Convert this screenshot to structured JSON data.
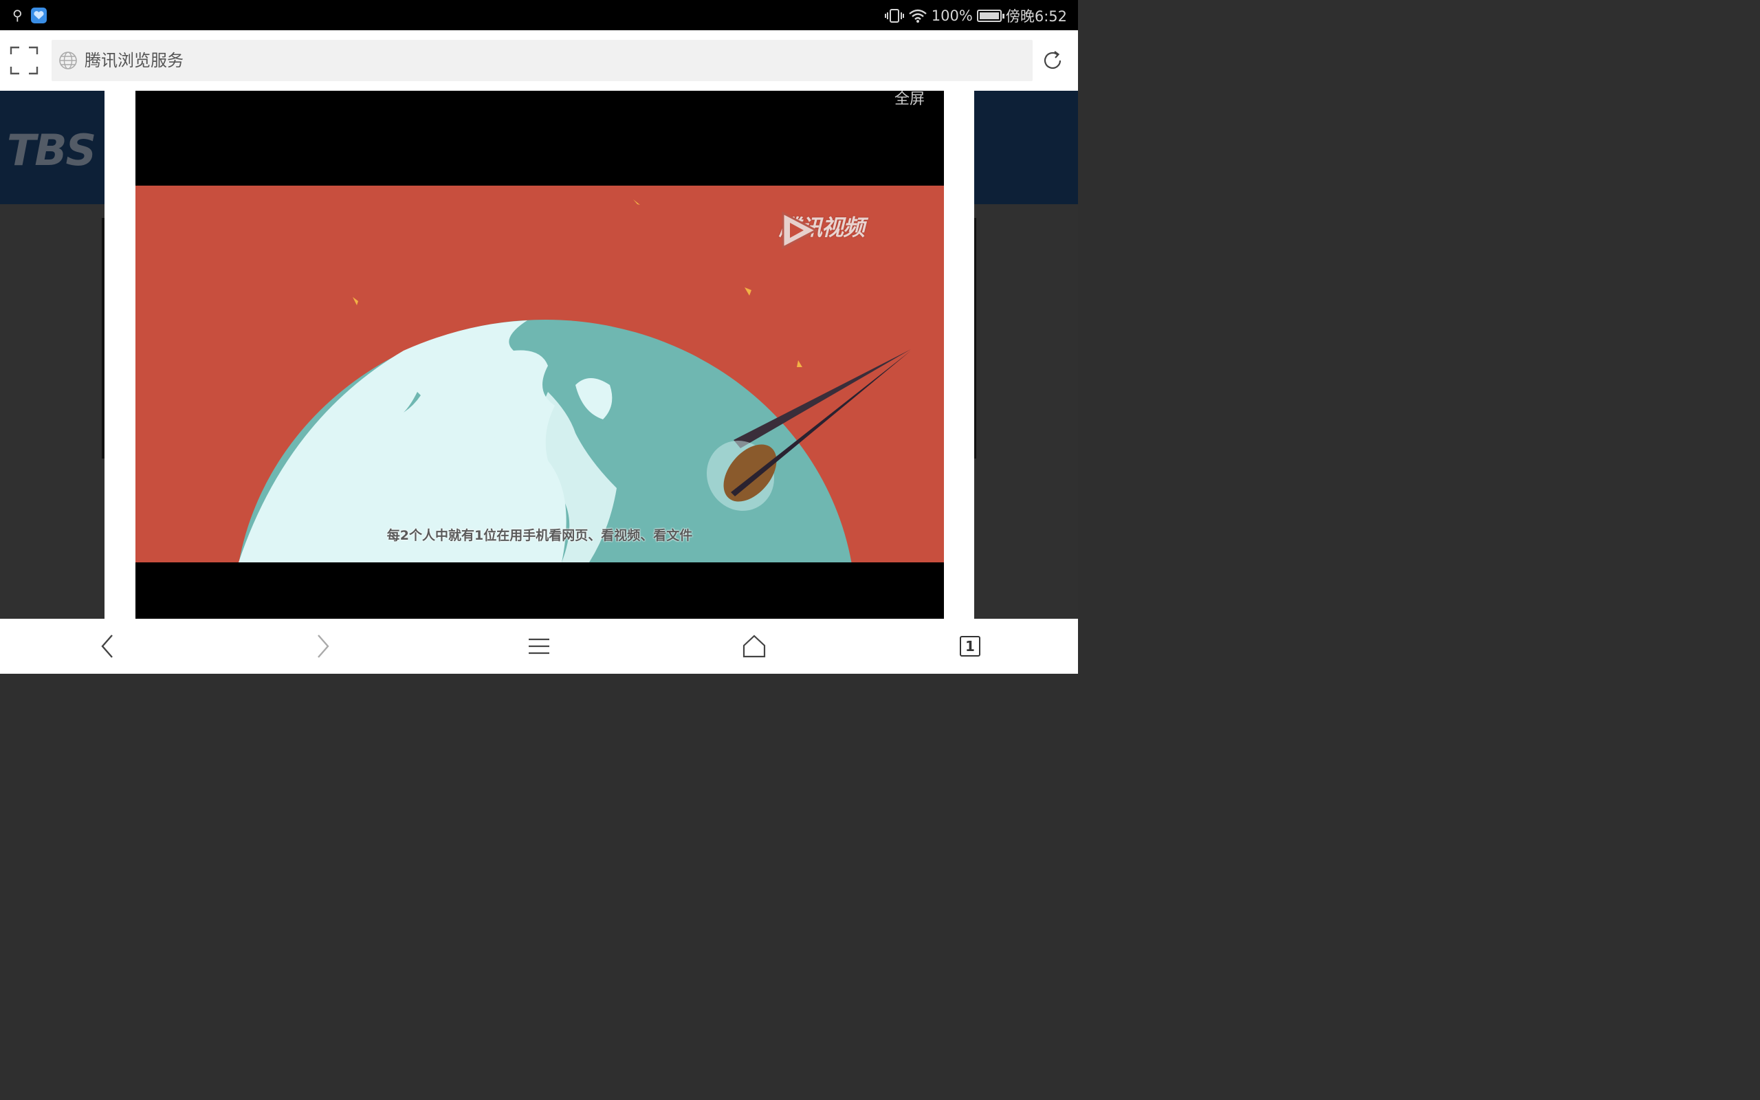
{
  "status_bar": {
    "battery_percent": "100%",
    "time": "傍晚6:52",
    "icons": [
      "usb-icon",
      "app-badge-icon",
      "vibrate-icon",
      "wifi-icon",
      "battery-charging-icon"
    ]
  },
  "address_bar": {
    "url_text": "腾讯浏览服务",
    "icons": [
      "scan-icon",
      "globe-icon",
      "refresh-icon"
    ]
  },
  "background_page": {
    "logo_text": "TBS"
  },
  "video": {
    "fullscreen_label": "全屏",
    "watermark": "腾讯视频",
    "subtitle": "每2个人中就有1位在用手机看网页、看视频、看文件",
    "colors": {
      "frame": "#c84f3e",
      "ocean": "#6fb7b1",
      "land": "#dff6f6"
    }
  },
  "navbar": {
    "tab_count": "1",
    "icons": [
      "back-icon",
      "forward-icon",
      "menu-icon",
      "home-icon",
      "tabs-icon"
    ]
  }
}
